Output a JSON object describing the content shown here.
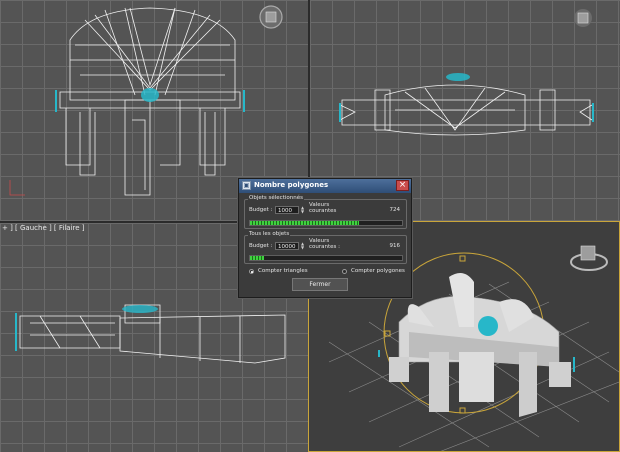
{
  "viewports": {
    "left": {
      "label": "+ ] [ Gauche ] [ Filaire ]"
    }
  },
  "dialog": {
    "title": "Nombre polygones",
    "close_icon": "close-icon",
    "selected": {
      "group_title": "Objets sélectionnés",
      "budget_label": "Budget :",
      "budget_value": "1000",
      "current_label": "Valeurs courantes",
      "current_value": "724",
      "progress": 0.72
    },
    "all": {
      "group_title": "Tous les objets",
      "budget_label": "Budget :",
      "budget_value": "10000",
      "current_label": "Valeurs courantes :",
      "current_value": "916",
      "progress": 0.09
    },
    "count_triangles": "Compter triangles",
    "count_polygons": "Compter polygones",
    "close_button": "Fermer"
  },
  "colors": {
    "accent_title": "#3b5f8c",
    "progress_green": "#3fd23f",
    "gizmo_cyan": "#27b7c9",
    "gizmo_ring": "#c9a53a"
  }
}
